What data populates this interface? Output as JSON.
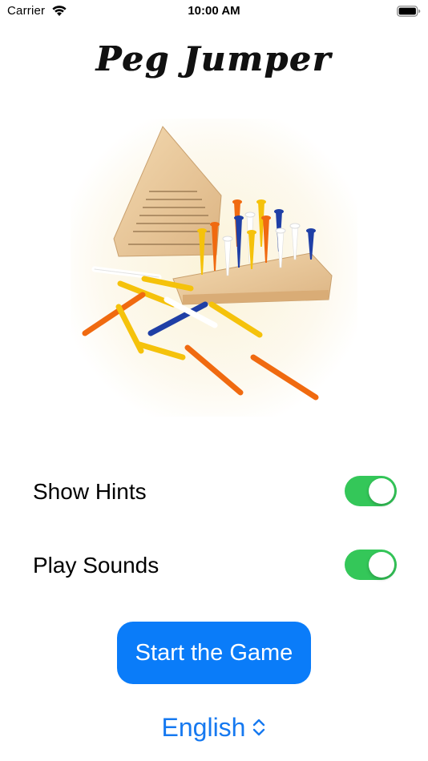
{
  "status_bar": {
    "carrier": "Carrier",
    "time": "10:00 AM"
  },
  "app": {
    "title": "Peg Jumper"
  },
  "settings": {
    "show_hints": {
      "label": "Show Hints",
      "on": true
    },
    "play_sounds": {
      "label": "Play Sounds",
      "on": true
    }
  },
  "start_button": {
    "label": "Start the Game"
  },
  "language": {
    "selected": "English"
  },
  "colors": {
    "toggle_on": "#34c759",
    "button": "#0a7cf9",
    "link": "#1679f0"
  }
}
